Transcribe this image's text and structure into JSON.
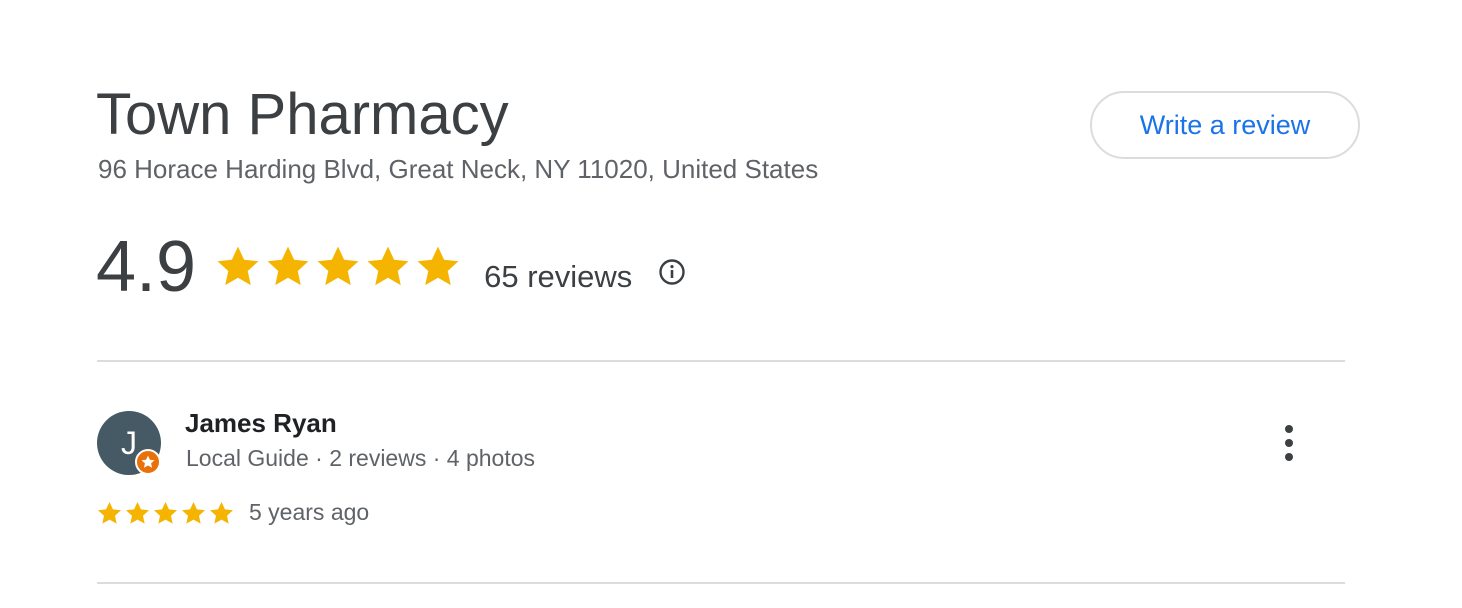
{
  "business": {
    "name": "Town Pharmacy",
    "address": "96 Horace Harding Blvd, Great Neck, NY 11020, United States",
    "write_review_label": "Write a review"
  },
  "rating": {
    "value": "4.9",
    "stars": 5,
    "review_count": "65 reviews",
    "info_icon": "info-icon",
    "star_color": "#f4b400"
  },
  "reviews": [
    {
      "avatar_initial": "J",
      "avatar_color": "#455a64",
      "badge_icon": "local-guide-star-icon",
      "badge_color": "#e8710a",
      "name": "James Ryan",
      "meta": "Local Guide · 2 reviews · 4 photos",
      "stars": 5,
      "time": "5 years ago",
      "menu_icon": "more-vert-icon"
    }
  ],
  "colors": {
    "link": "#1a73e8",
    "text": "#3c4043",
    "secondary": "#5f6368",
    "divider": "#dadce0"
  }
}
